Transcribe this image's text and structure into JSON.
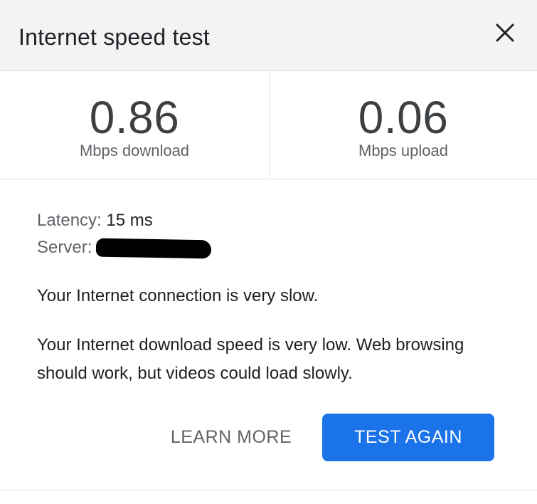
{
  "dialog": {
    "title": "Internet speed test",
    "close_icon": "close-icon"
  },
  "download": {
    "value": "0.86",
    "unit": "Mbps download"
  },
  "upload": {
    "value": "0.06",
    "unit": "Mbps upload"
  },
  "details": {
    "latency_label": "Latency:",
    "latency_value": "15 ms",
    "server_label": "Server:"
  },
  "messages": {
    "summary": "Your Internet connection is very slow.",
    "detail": "Your Internet download speed is very low. Web browsing should work, but videos could load slowly."
  },
  "actions": {
    "learn_more": "LEARN MORE",
    "test_again": "TEST AGAIN"
  },
  "colors": {
    "accent": "#1a73e8",
    "header_bg": "#f1f3f4"
  }
}
